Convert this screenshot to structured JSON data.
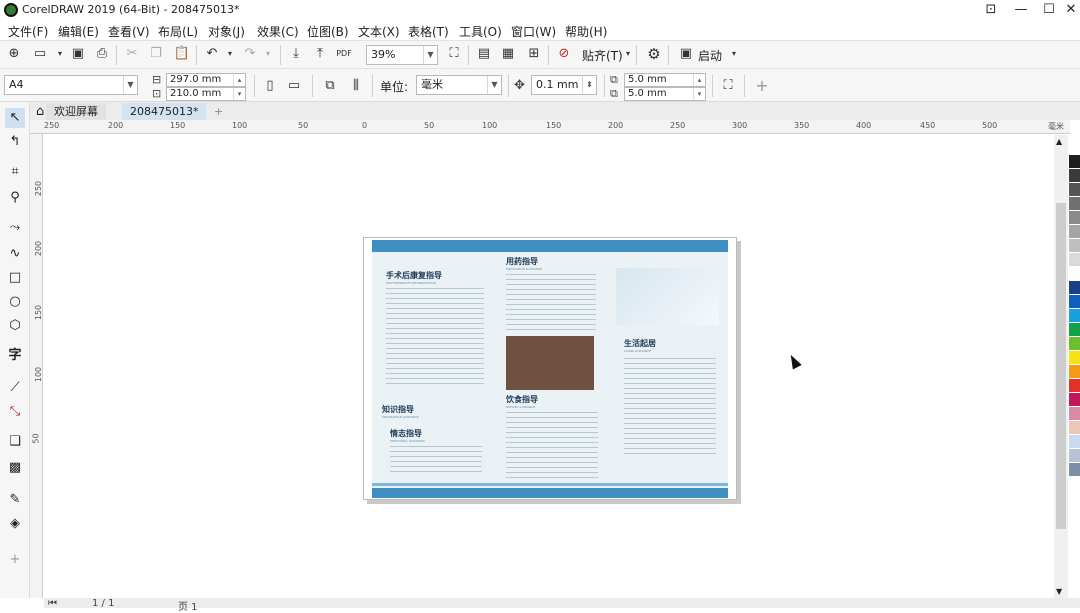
{
  "window": {
    "title": "CorelDRAW 2019 (64-Bit) - 208475013*"
  },
  "menu": [
    "文件(F)",
    "编辑(E)",
    "查看(V)",
    "布局(L)",
    "对象(J)",
    "效果(C)",
    "位图(B)",
    "文本(X)",
    "表格(T)",
    "工具(O)",
    "窗口(W)",
    "帮助(H)"
  ],
  "toolbar": {
    "zoom": "39%",
    "snap_label": "贴齐(T)",
    "launch_label": "启动"
  },
  "props": {
    "page_size": "A4",
    "width": "297.0 mm",
    "height": "210.0 mm",
    "unit_label": "单位:",
    "unit": "毫米",
    "nudge": "0.1 mm",
    "dup_x": "5.0 mm",
    "dup_y": "5.0 mm"
  },
  "tabs": {
    "welcome": "欢迎屏幕",
    "doc": "208475013*"
  },
  "ruler": {
    "h": [
      "250",
      "200",
      "150",
      "100",
      "50",
      "0",
      "50",
      "100",
      "150",
      "200",
      "250",
      "300",
      "350",
      "400",
      "450",
      "500"
    ],
    "unit": "毫米",
    "v": [
      "250",
      "200",
      "150",
      "100",
      "50"
    ]
  },
  "brochure": {
    "h1": "手术后康复指导",
    "h1_sub": "POSTOPERATIVE REHABILITATION",
    "h2": "用药指导",
    "h2_sub": "MEDICATION GUIDANCE",
    "h3": "生活起居",
    "h3_sub": "LIVING GUIDANCE",
    "h4": "知识指导",
    "h4_sub": "KNOWLEDGE GUIDANCE",
    "h5": "情志指导",
    "h5_sub": "EMOTIONAL GUIDANCE",
    "h6": "饮食指导",
    "h6_sub": "DIETARY GUIDANCE"
  },
  "status": {
    "page": "页 1",
    "pages": "1 / 1"
  },
  "palette": [
    "#1f1f1f",
    "#3a3a3a",
    "#555555",
    "#707070",
    "#8a8a8a",
    "#a5a5a5",
    "#bfbfbf",
    "#dadada",
    "#ffffff",
    "#1a3f8a",
    "#0f5fbf",
    "#1aa0df",
    "#12a24b",
    "#6cbf2a",
    "#f4e316",
    "#f39a17",
    "#e5302a",
    "#c2185b",
    "#d98aa6",
    "#e9c9b5",
    "#c9d9ef",
    "#b8c3d6",
    "#7f8ea8"
  ]
}
